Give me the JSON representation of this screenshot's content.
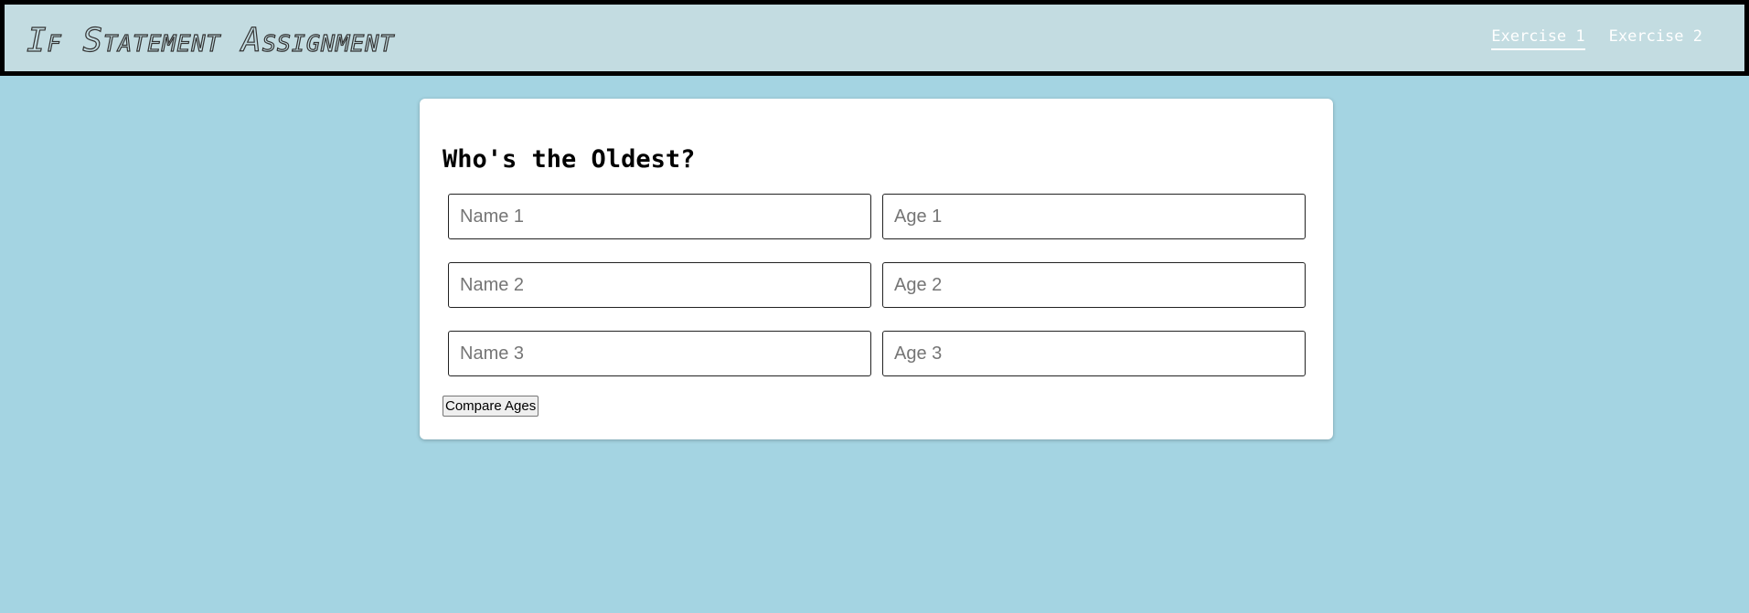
{
  "header": {
    "title": "If Statement Assignment",
    "nav": [
      {
        "label": "Exercise 1",
        "active": true
      },
      {
        "label": "Exercise 2",
        "active": false
      }
    ]
  },
  "main": {
    "title": "Who's the Oldest?",
    "fields": {
      "name1": {
        "placeholder": "Name 1",
        "value": ""
      },
      "age1": {
        "placeholder": "Age 1",
        "value": ""
      },
      "name2": {
        "placeholder": "Name 2",
        "value": ""
      },
      "age2": {
        "placeholder": "Age 2",
        "value": ""
      },
      "name3": {
        "placeholder": "Name 3",
        "value": ""
      },
      "age3": {
        "placeholder": "Age 3",
        "value": ""
      }
    },
    "compare_label": "Compare Ages"
  },
  "colors": {
    "page_background": "#a4d4e2",
    "header_background": "#c3dce1",
    "header_border": "#000000",
    "card_background": "#ffffff",
    "nav_link": "#ffffff"
  }
}
